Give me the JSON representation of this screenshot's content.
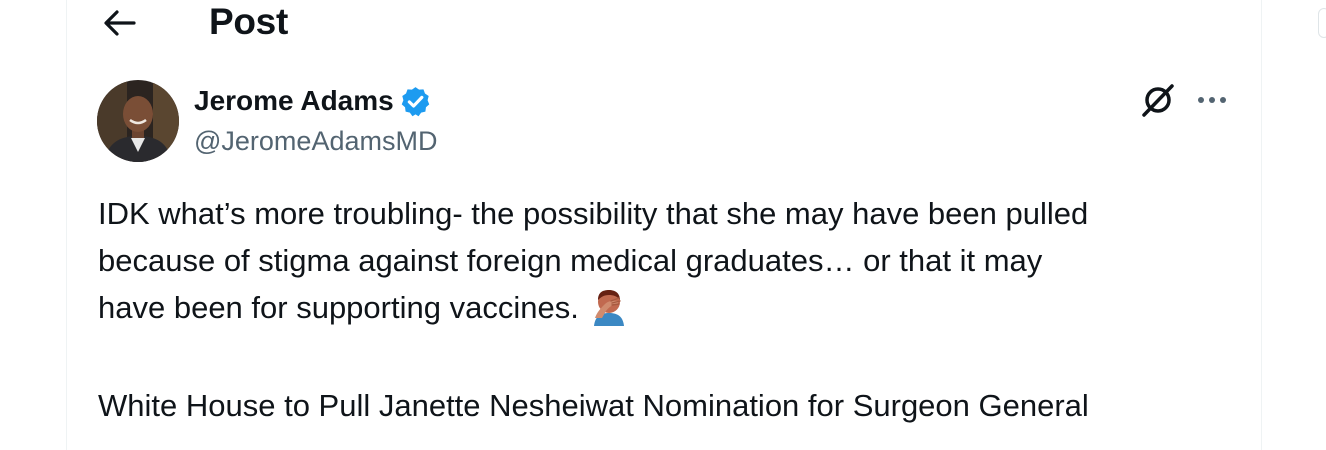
{
  "header": {
    "title": "Post",
    "back_icon": "arrow-left-icon"
  },
  "author": {
    "display_name": "Jerome Adams",
    "handle": "@JeromeAdamsMD",
    "verified": true,
    "verified_color": "#1d9bf0"
  },
  "actions": {
    "grok_icon": "grok-icon",
    "more_icon": "more-horizontal-icon"
  },
  "post": {
    "lines": [
      "IDK what’s more troubling- the possibility that she may have been pulled",
      "because of stigma against foreign medical graduates… or that it may",
      "have been for supporting vaccines."
    ],
    "emoji": "facepalm-emoji",
    "headline": "White House to Pull Janette Nesheiwat Nomination for Surgeon General"
  },
  "colors": {
    "text": "#0f1419",
    "secondary": "#536471",
    "border": "#eff3f4"
  }
}
